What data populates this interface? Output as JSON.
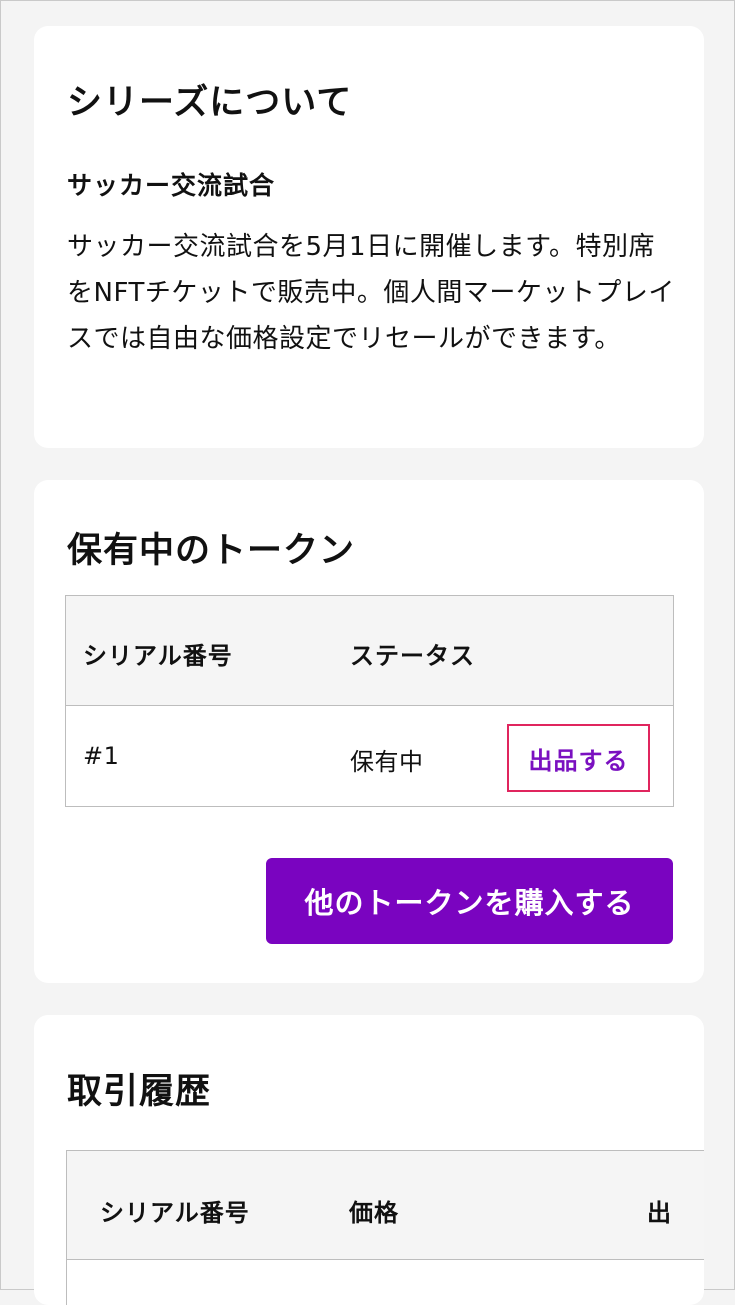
{
  "about": {
    "title": "シリーズについて",
    "subtitle": "サッカー交流試合",
    "description": "サッカー交流試合を5月1日に開催します。特別席をNFTチケットで販売中。個人間マーケットプレイスでは自由な価格設定でリセールができます。"
  },
  "tokens": {
    "title": "保有中のトークン",
    "columns": [
      "シリアル番号",
      "ステータス"
    ],
    "rows": [
      {
        "serial": "#1",
        "status": "保有中",
        "action": "出品する"
      }
    ],
    "buy_button": "他のトークンを購入する"
  },
  "history": {
    "title": "取引履歴",
    "columns": [
      "シリアル番号",
      "価格",
      "出"
    ]
  },
  "colors": {
    "accent": "#7a04c0",
    "highlight_border": "#e0255e",
    "page_bg": "#f4f4f4"
  }
}
